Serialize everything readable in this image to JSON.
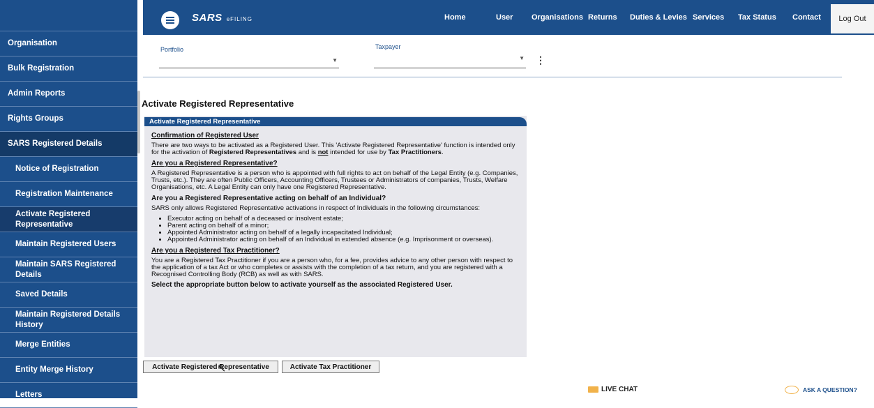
{
  "header": {
    "logo": "SARS",
    "logo_sub": "eFILING",
    "nav": [
      "Home",
      "User",
      "Organisations",
      "Returns",
      "Duties & Levies",
      "Services",
      "Tax Status",
      "Contact"
    ],
    "logout": "Log Out"
  },
  "sidebar": {
    "items": [
      {
        "label": "Organisation",
        "level": 1
      },
      {
        "label": "Bulk Registration",
        "level": 1
      },
      {
        "label": "Admin Reports",
        "level": 1
      },
      {
        "label": "Rights Groups",
        "level": 1
      },
      {
        "label": "SARS Registered Details",
        "level": 1
      },
      {
        "label": "Notice of Registration",
        "level": 2
      },
      {
        "label": "Registration Maintenance",
        "level": 2
      },
      {
        "label": "Activate Registered Representative",
        "level": 2
      },
      {
        "label": "Maintain Registered Users",
        "level": 2
      },
      {
        "label": "Maintain SARS Registered Details",
        "level": 2
      },
      {
        "label": "Saved Details",
        "level": 2
      },
      {
        "label": "Maintain Registered Details History",
        "level": 2
      },
      {
        "label": "Merge Entities",
        "level": 2
      },
      {
        "label": "Entity Merge History",
        "level": 2
      },
      {
        "label": "Letters",
        "level": 2
      }
    ]
  },
  "filters": {
    "portfolio_label": "Portfolio",
    "taxpayer_label": "Taxpayer"
  },
  "page": {
    "title": "Activate Registered Representative"
  },
  "panel": {
    "header": "Activate Registered Representative",
    "h1": "Confirmation of Registered User",
    "p1a": "There are two ways to be activated as a Registered User. This 'Activate Registered Representative' function is intended only for the activation of ",
    "p1b": "Registered Representatives",
    "p1c": " and is ",
    "p1d": "not",
    "p1e": " intended for use by ",
    "p1f": "Tax Practitioners",
    "p1g": ".",
    "h2": "Are you a Registered Representative?",
    "p2": "A Registered Representative is a person who is appointed with full rights to act on behalf of the Legal Entity (e.g. Companies, Trusts, etc.). They are often Public Officers, Accounting Officers, Trustees or Administrators of companies, Trusts, Welfare Organisations, etc.  A  Legal Entity can only have one Registered Representative.",
    "h3": "Are you a Registered Representative acting on behalf of an Individual?",
    "p3": "SARS only allows Registered Representative activations in respect of Individuals in the following circumstances:",
    "list": [
      "Executor acting on behalf of a deceased or insolvent estate;",
      "Parent acting on behalf of a minor;",
      "Appointed Administrator acting on behalf of a legally incapacitated Individual;",
      "Appointed Administrator acting on behalf of an Individual in extended absence (e.g. Imprisonment or overseas)."
    ],
    "h4": "Are you a Registered Tax Practitioner?",
    "p4": "You are a Registered Tax Practitioner if you are a person who, for a fee, provides advice to any other person with respect to the application of a tax Act or who completes or assists with the completion of a tax return, and you are registered with a Recognised Controlling Body (RCB) as well as with SARS.",
    "p5": "Select the appropriate button below to activate yourself as the associated Registered User."
  },
  "buttons": {
    "activate_rep": "Activate Registered Representative",
    "activate_tp": "Activate Tax Practitioner"
  },
  "footer": {
    "live_chat": "LIVE CHAT",
    "ask": "ASK A QUESTION?"
  },
  "colors": {
    "brand": "#1c4f8b",
    "accent": "#f1b24a"
  }
}
